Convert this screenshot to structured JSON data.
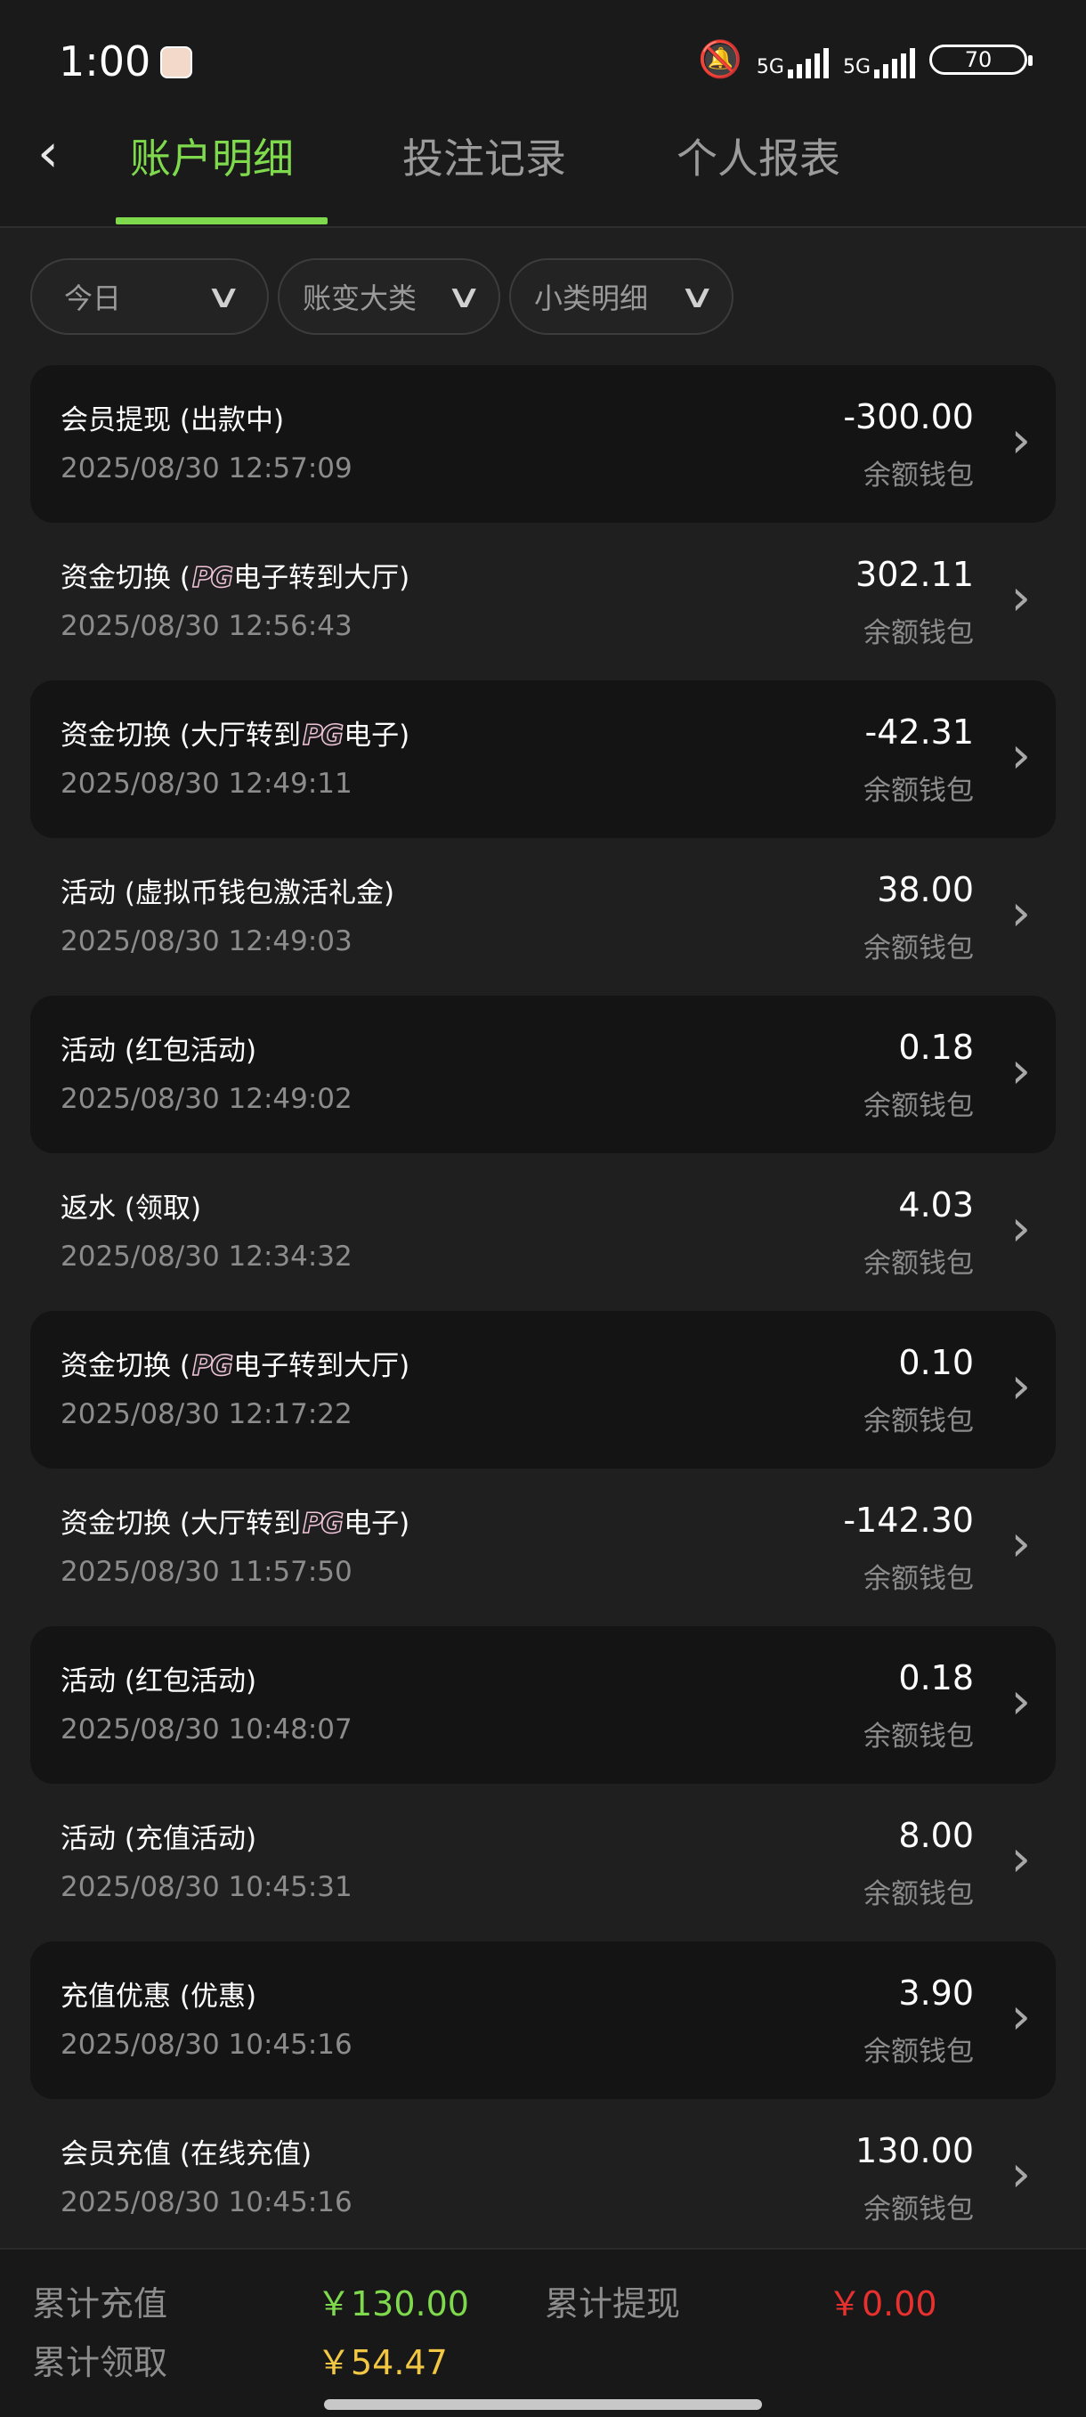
{
  "status": {
    "time": "1:00",
    "net1": "5G",
    "net2": "5G",
    "battery": "70"
  },
  "tabs": [
    {
      "label": "账户明细",
      "active": true
    },
    {
      "label": "投注记录",
      "active": false
    },
    {
      "label": "个人报表",
      "active": false
    }
  ],
  "filters": [
    {
      "label": "今日"
    },
    {
      "label": "账变大类"
    },
    {
      "label": "小类明细"
    }
  ],
  "records": [
    {
      "title": "会员提现 (出款中)",
      "date": "2025/08/30 12:57:09",
      "amount": "-300.00",
      "wallet": "余额钱包"
    },
    {
      "title_pre": "资金切换 (",
      "badge": "PG",
      "title_post": "电子转到大厅)",
      "date": "2025/08/30 12:56:43",
      "amount": "302.11",
      "wallet": "余额钱包"
    },
    {
      "title_pre": "资金切换 (大厅转到",
      "badge": "PG",
      "title_post": "电子)",
      "date": "2025/08/30 12:49:11",
      "amount": "-42.31",
      "wallet": "余额钱包"
    },
    {
      "title": "活动 (虚拟币钱包激活礼金)",
      "date": "2025/08/30 12:49:03",
      "amount": "38.00",
      "wallet": "余额钱包"
    },
    {
      "title": "活动 (红包活动)",
      "date": "2025/08/30 12:49:02",
      "amount": "0.18",
      "wallet": "余额钱包"
    },
    {
      "title": "返水 (领取)",
      "date": "2025/08/30 12:34:32",
      "amount": "4.03",
      "wallet": "余额钱包"
    },
    {
      "title_pre": "资金切换 (",
      "badge": "PG",
      "title_post": "电子转到大厅)",
      "date": "2025/08/30 12:17:22",
      "amount": "0.10",
      "wallet": "余额钱包"
    },
    {
      "title_pre": "资金切换 (大厅转到",
      "badge": "PG",
      "title_post": "电子)",
      "date": "2025/08/30 11:57:50",
      "amount": "-142.30",
      "wallet": "余额钱包"
    },
    {
      "title": "活动 (红包活动)",
      "date": "2025/08/30 10:48:07",
      "amount": "0.18",
      "wallet": "余额钱包"
    },
    {
      "title": "活动 (充值活动)",
      "date": "2025/08/30 10:45:31",
      "amount": "8.00",
      "wallet": "余额钱包"
    },
    {
      "title": "充值优惠 (优惠)",
      "date": "2025/08/30 10:45:16",
      "amount": "3.90",
      "wallet": "余额钱包"
    },
    {
      "title": "会员充值 (在线充值)",
      "date": "2025/08/30 10:45:16",
      "amount": "130.00",
      "wallet": "余额钱包"
    }
  ],
  "summary": {
    "deposit_label": "累计充值",
    "deposit_value": "￥130.00",
    "withdraw_label": "累计提现",
    "withdraw_value": "￥0.00",
    "claimed_label": "累计领取",
    "claimed_value": "￥54.47"
  },
  "colors": {
    "accent": "#7fd94d",
    "negative": "#e8302f",
    "highlight": "#f2c744"
  }
}
